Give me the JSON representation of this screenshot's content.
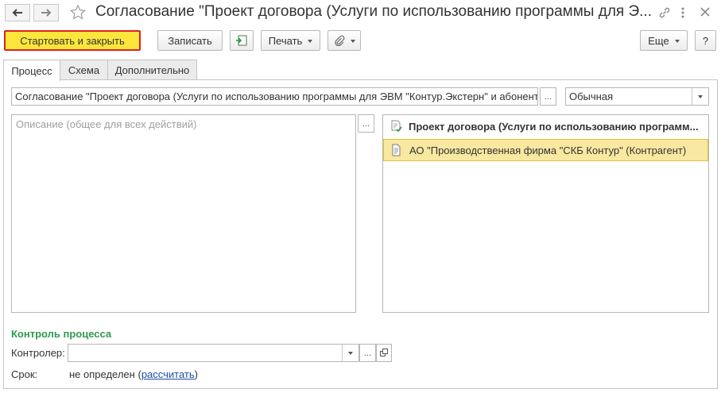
{
  "window": {
    "title": "Согласование \"Проект договора (Услуги по использованию программы для Э...",
    "icons": [
      "back-arrow-icon",
      "forward-arrow-icon",
      "star-icon",
      "link-icon",
      "more-icon",
      "close-icon"
    ]
  },
  "toolbar": {
    "start_close": "Стартовать и закрыть",
    "save": "Записать",
    "print": "Печать",
    "more": "Еще",
    "help": "?"
  },
  "tabs": [
    {
      "label": "Процесс",
      "active": true
    },
    {
      "label": "Схема",
      "active": false
    },
    {
      "label": "Дополнительно",
      "active": false
    }
  ],
  "form": {
    "subject_value": "Согласование \"Проект договора (Услуги по использованию программы для ЭВМ \"Контур.Экстерн\" и абонентс",
    "importance_value": "Обычная",
    "description_placeholder": "Описание (общее для всех действий)",
    "ellipsis": "..."
  },
  "tree": {
    "root": "Проект договора (Услуги по использованию программ...",
    "item": "АО \"Производственная фирма \"СКБ Контур\" (Контрагент)"
  },
  "control": {
    "section_title": "Контроль процесса",
    "controller_label": "Контролер:",
    "controller_value": "",
    "deadline_label": "Срок:",
    "deadline_value": "не определен",
    "paren_open": "(",
    "calc_link": "рассчитать",
    "paren_close": ")"
  },
  "colors": {
    "primary_button": "#fde63c",
    "primary_border": "#e02020",
    "section_title": "#2e9a4e",
    "selected_row": "#f8e8a0",
    "link": "#1a4fa8"
  }
}
